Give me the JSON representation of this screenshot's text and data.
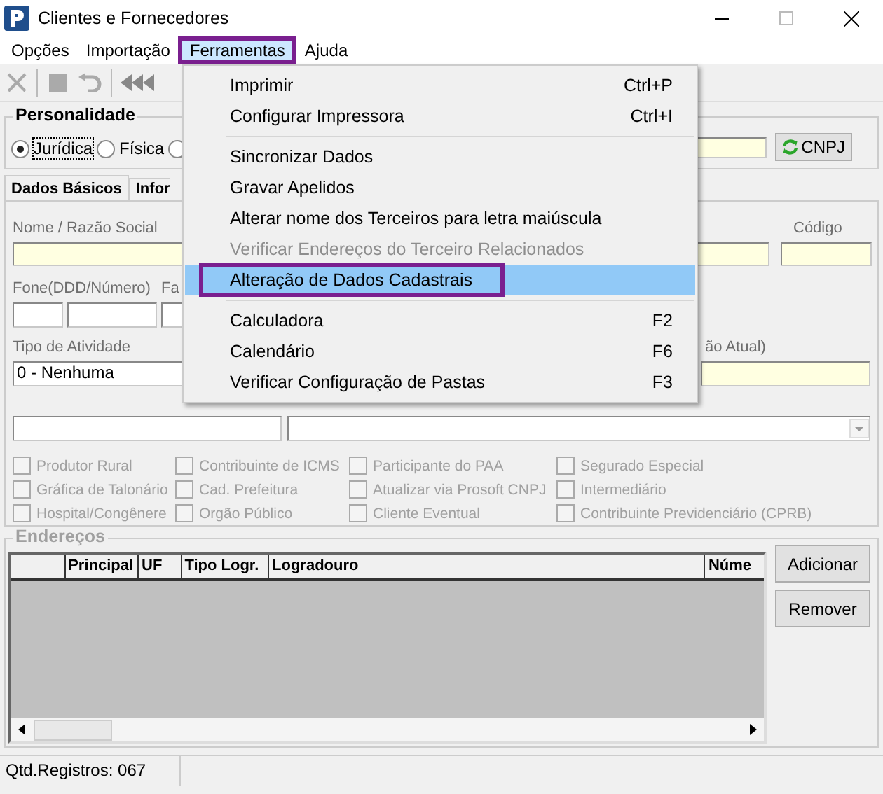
{
  "window": {
    "title": "Clientes e Fornecedores"
  },
  "menu_bar": [
    {
      "label": "Opções",
      "selected": false
    },
    {
      "label": "Importação",
      "selected": false
    },
    {
      "label": "Ferramentas",
      "selected": true
    },
    {
      "label": "Ajuda",
      "selected": false
    }
  ],
  "personalidade": {
    "title": "Personalidade",
    "options": [
      {
        "label": "Jurídica",
        "selected": true
      },
      {
        "label": "Física",
        "selected": false
      },
      {
        "selected": false
      }
    ],
    "cnpj_button": "CNPJ"
  },
  "tabs": [
    {
      "label": "Dados Básicos",
      "selected": true
    },
    {
      "label": "Infor",
      "selected": false
    }
  ],
  "form": {
    "name_label": "Nome / Razão Social",
    "code_label": "Código",
    "phone_label": "Fone(DDD/Número)",
    "fax_label": "Fa",
    "activity_label": "Tipo de Atividade",
    "activity_value": "0 - Nenhuma",
    "right_label": "ão Atual)"
  },
  "checkboxes": [
    {
      "label": "Produtor Rural",
      "checked": false,
      "disabled": true
    },
    {
      "label": "Gráfica de Talonário",
      "checked": false,
      "disabled": true
    },
    {
      "label": "Hospital/Congênere",
      "checked": false,
      "disabled": true
    },
    {
      "label": "Contribuinte de ICMS",
      "checked": false,
      "disabled": true
    },
    {
      "label": "Cad. Prefeitura",
      "checked": false,
      "disabled": true
    },
    {
      "label": "Orgão Público",
      "checked": false,
      "disabled": true
    },
    {
      "label": "Participante do PAA",
      "checked": false,
      "disabled": true
    },
    {
      "label": "Atualizar via Prosoft CNPJ",
      "checked": false,
      "disabled": true
    },
    {
      "label": "Cliente Eventual",
      "checked": false,
      "disabled": true
    },
    {
      "label": "Segurado Especial",
      "checked": false,
      "disabled": true
    },
    {
      "label": "Intermediário",
      "checked": false,
      "disabled": true
    },
    {
      "label": "Contribuinte Previdenciário (CPRB)",
      "checked": false,
      "disabled": true
    }
  ],
  "addresses": {
    "title": "Endereços",
    "columns": [
      "Principal",
      "UF",
      "Tipo Logr.",
      "Logradouro",
      "Núme"
    ],
    "buttons": [
      "Adicionar",
      "Remover"
    ]
  },
  "status_bar": [
    "Qtd.Registros: 067"
  ],
  "dropdown_menu": [
    {
      "kind": "item",
      "label": "Imprimir",
      "shortcut": "Ctrl+P",
      "disabled": false,
      "selected": false
    },
    {
      "kind": "item",
      "label": "Configurar Impressora",
      "shortcut": "Ctrl+I",
      "disabled": false,
      "selected": false
    },
    {
      "kind": "separator"
    },
    {
      "kind": "item",
      "label": "Sincronizar Dados",
      "disabled": false,
      "selected": false
    },
    {
      "kind": "item",
      "label": "Gravar Apelidos",
      "disabled": false,
      "selected": false
    },
    {
      "kind": "item",
      "label": "Alterar nome dos Terceiros para letra maiúscula",
      "disabled": false,
      "selected": false
    },
    {
      "kind": "item",
      "label": "Verificar Endereços do Terceiro Relacionados",
      "disabled": true,
      "selected": false
    },
    {
      "kind": "item",
      "label": "Alteração de Dados Cadastrais",
      "disabled": false,
      "selected": true
    },
    {
      "kind": "separator"
    },
    {
      "kind": "item",
      "label": "Calculadora",
      "shortcut": "F2",
      "disabled": false,
      "selected": false
    },
    {
      "kind": "item",
      "label": "Calendário",
      "shortcut": "F6",
      "disabled": false,
      "selected": false
    },
    {
      "kind": "item",
      "label": "Verificar Configuração de Pastas",
      "shortcut": "F3",
      "disabled": false,
      "selected": false
    }
  ]
}
